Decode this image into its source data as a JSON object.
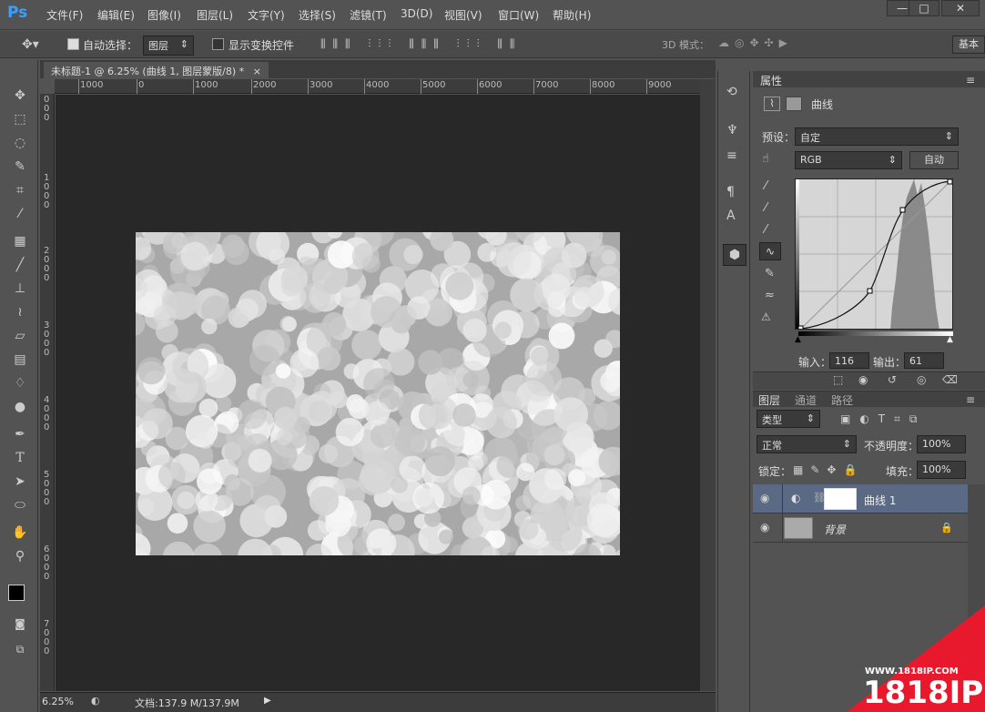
{
  "app": {
    "logo": "Ps",
    "workspace_label": "基本"
  },
  "menu": {
    "items": [
      "文件(F)",
      "编辑(E)",
      "图像(I)",
      "图层(L)",
      "文字(Y)",
      "选择(S)",
      "滤镜(T)",
      "3D(D)",
      "视图(V)",
      "窗口(W)",
      "帮助(H)"
    ]
  },
  "window_controls": {
    "min": "—",
    "max": "□",
    "close": "✕"
  },
  "options": {
    "auto_select_label": "自动选择：",
    "auto_select_value": "图层",
    "transform_label": "显示变换控件",
    "mode3d_label": "3D 模式："
  },
  "document": {
    "tab_title": "未标题-1 @ 6.25% (曲线 1, 图层蒙版/8) *",
    "close_glyph": "×",
    "hruler_labels": [
      "1000",
      "0",
      "1000",
      "2000",
      "3000",
      "4000",
      "5000",
      "6000",
      "7000",
      "8000",
      "9000"
    ],
    "vruler_labels": [
      "0 0 0",
      "1 0 0 0",
      "2 0 0 0",
      "3 0 0 0",
      "4 0 0 0",
      "5 0 0 0",
      "6 0 0 0",
      "7 0 0 0"
    ],
    "zoom": "6.25%",
    "doc_info": "文档:137.9 M/137.9M"
  },
  "properties": {
    "tab": "属性",
    "adjustment_title": "曲线",
    "preset_label": "预设：",
    "preset_value": "自定",
    "channel_value": "RGB",
    "auto_button": "自动",
    "input_label": "输入：",
    "input_value": "116",
    "output_label": "输出：",
    "output_value": "61"
  },
  "layers_panel": {
    "tabs": [
      "图层",
      "通道",
      "路径"
    ],
    "filter_label": "类型",
    "blend_mode": "正常",
    "opacity_label": "不透明度：",
    "opacity_value": "100%",
    "lock_label": "锁定：",
    "fill_label": "填充：",
    "fill_value": "100%",
    "layers": [
      {
        "name": "曲线 1"
      },
      {
        "name": "背景"
      }
    ]
  },
  "watermark": {
    "url": "WWW.1818IP.COM",
    "brand": "1818IP"
  },
  "colors": {
    "accent": "#3aa0ff",
    "selected_layer": "#5b6a84",
    "watermark": "#e8192c"
  }
}
